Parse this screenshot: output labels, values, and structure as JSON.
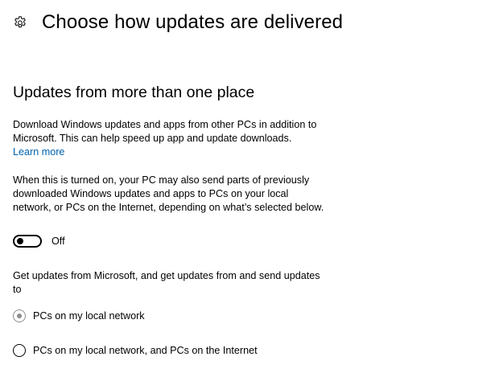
{
  "header": {
    "icon": "gear-icon",
    "title": "Choose how updates are delivered"
  },
  "section": {
    "title": "Updates from more than one place",
    "description": "Download Windows updates and apps from other PCs in addition to Microsoft. This can help speed up app and update downloads.",
    "learn_more": "Learn more",
    "detail": "When this is turned on, your PC may also send parts of previously downloaded Windows updates and apps to PCs on your local network, or PCs on the Internet, depending on what’s selected below.",
    "toggle": {
      "state_label": "Off",
      "on": false
    },
    "options_prompt": "Get updates from Microsoft, and get updates from and send updates to",
    "options": [
      {
        "label": "PCs on my local network",
        "selected": true,
        "disabled": true
      },
      {
        "label": "PCs on my local network, and PCs on the Internet",
        "selected": false,
        "disabled": false
      }
    ]
  },
  "colors": {
    "link": "#0063b1",
    "disabled_radio": "#8c8c8c",
    "text": "#000000",
    "background": "#ffffff"
  }
}
